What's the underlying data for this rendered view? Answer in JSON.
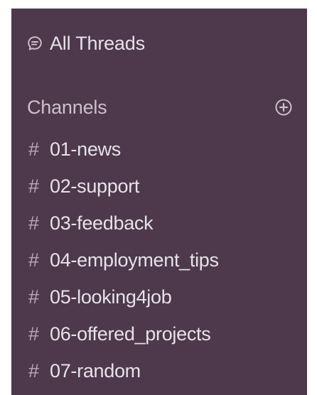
{
  "sidebar": {
    "all_threads": {
      "label": "All Threads",
      "icon": "threads-icon"
    },
    "channels": {
      "header": "Channels",
      "add_icon": "add-channel-icon",
      "hash_symbol": "#",
      "items": [
        {
          "name": "01-news"
        },
        {
          "name": "02-support"
        },
        {
          "name": "03-feedback"
        },
        {
          "name": "04-employment_tips"
        },
        {
          "name": "05-looking4job"
        },
        {
          "name": "06-offered_projects"
        },
        {
          "name": "07-random"
        }
      ]
    }
  },
  "colors": {
    "sidebar_bg": "#4d394b",
    "text_primary": "#e8e1e8",
    "text_muted": "#cdbfcc"
  }
}
